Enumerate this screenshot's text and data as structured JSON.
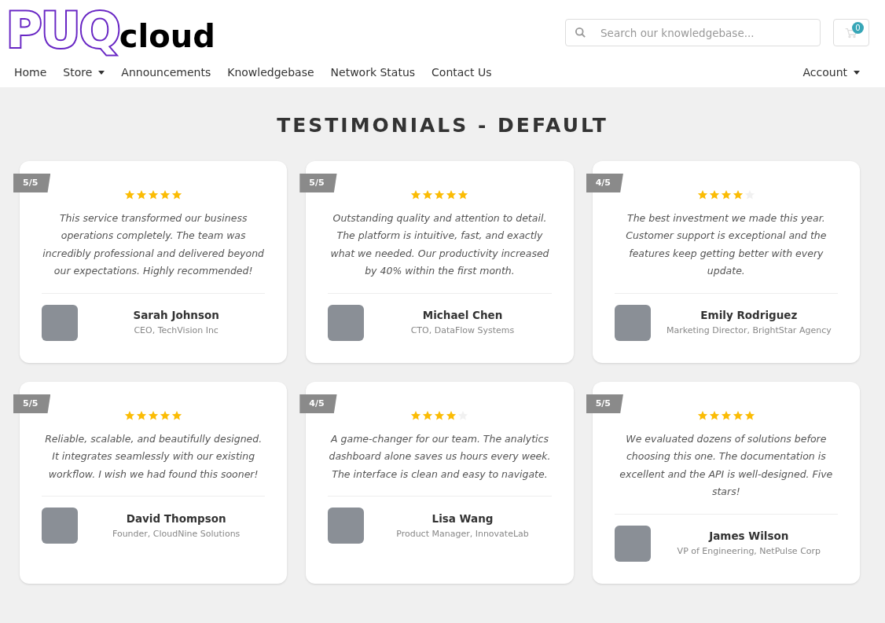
{
  "logo": {
    "mark": "PUQ",
    "word": "cloud"
  },
  "search": {
    "placeholder": "Search our knowledgebase..."
  },
  "cart": {
    "count": "0"
  },
  "nav": [
    {
      "label": "Home",
      "dropdown": false
    },
    {
      "label": "Store",
      "dropdown": true
    },
    {
      "label": "Announcements",
      "dropdown": false
    },
    {
      "label": "Knowledgebase",
      "dropdown": false
    },
    {
      "label": "Network Status",
      "dropdown": false
    },
    {
      "label": "Contact Us",
      "dropdown": false
    }
  ],
  "account": {
    "label": "Account",
    "dropdown": true
  },
  "title": "TESTIMONIALS - DEFAULT",
  "testimonials": [
    {
      "rating": "5/5",
      "stars": 5,
      "quote": "This service transformed our business operations completely. The team was incredibly professional and delivered beyond our expectations. Highly recommended!",
      "name": "Sarah Johnson",
      "role": "CEO, TechVision Inc"
    },
    {
      "rating": "5/5",
      "stars": 5,
      "quote": "Outstanding quality and attention to detail. The platform is intuitive, fast, and exactly what we needed. Our productivity increased by 40% within the first month.",
      "name": "Michael Chen",
      "role": "CTO, DataFlow Systems"
    },
    {
      "rating": "4/5",
      "stars": 4,
      "quote": "The best investment we made this year. Customer support is exceptional and the features keep getting better with every update.",
      "name": "Emily Rodriguez",
      "role": "Marketing Director, BrightStar Agency"
    },
    {
      "rating": "5/5",
      "stars": 5,
      "quote": "Reliable, scalable, and beautifully designed. It integrates seamlessly with our existing workflow. I wish we had found this sooner!",
      "name": "David Thompson",
      "role": "Founder, CloudNine Solutions"
    },
    {
      "rating": "4/5",
      "stars": 4,
      "quote": "A game-changer for our team. The analytics dashboard alone saves us hours every week. The interface is clean and easy to navigate.",
      "name": "Lisa Wang",
      "role": "Product Manager, InnovateLab"
    },
    {
      "rating": "5/5",
      "stars": 5,
      "quote": "We evaluated dozens of solutions before choosing this one. The documentation is excellent and the API is well-designed. Five stars!",
      "name": "James Wilson",
      "role": "VP of Engineering, NetPulse Corp"
    }
  ]
}
